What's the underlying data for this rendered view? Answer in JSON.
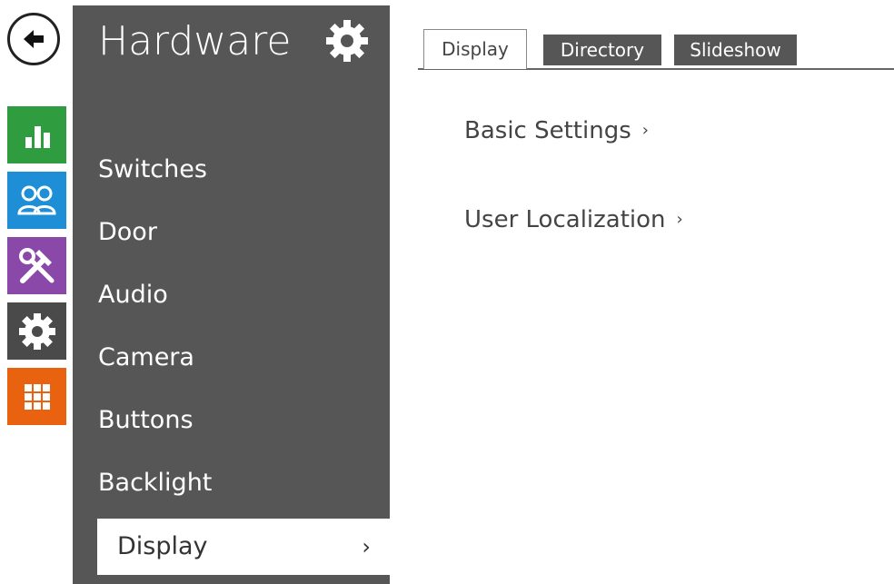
{
  "sidebar": {
    "title": "Hardware",
    "items": [
      {
        "label": "Switches"
      },
      {
        "label": "Door"
      },
      {
        "label": "Audio"
      },
      {
        "label": "Camera"
      },
      {
        "label": "Buttons"
      },
      {
        "label": "Backlight"
      },
      {
        "label": "Display",
        "active": true
      }
    ],
    "active_chevron": "›"
  },
  "iconbar": {
    "items": [
      {
        "icon": "back-arrow-icon"
      },
      {
        "icon": "bar-chart-icon",
        "color": "#2e9c3f"
      },
      {
        "icon": "users-icon",
        "color": "#1e8fd6"
      },
      {
        "icon": "tools-icon",
        "color": "#8a48a8"
      },
      {
        "icon": "gear-icon",
        "color": "#4a4a4a"
      },
      {
        "icon": "grid-icon",
        "color": "#e8620f"
      }
    ]
  },
  "tabs": [
    {
      "label": "Display",
      "active": true
    },
    {
      "label": "Directory"
    },
    {
      "label": "Slideshow"
    }
  ],
  "main": {
    "links": [
      {
        "label": "Basic Settings",
        "chevron": "›"
      },
      {
        "label": "User Localization",
        "chevron": "›"
      }
    ]
  },
  "colors": {
    "sidebar_bg": "#565656",
    "accent_green": "#2e9c3f",
    "accent_blue": "#1e8fd6",
    "accent_purple": "#8a48a8",
    "accent_orange": "#e8620f"
  }
}
